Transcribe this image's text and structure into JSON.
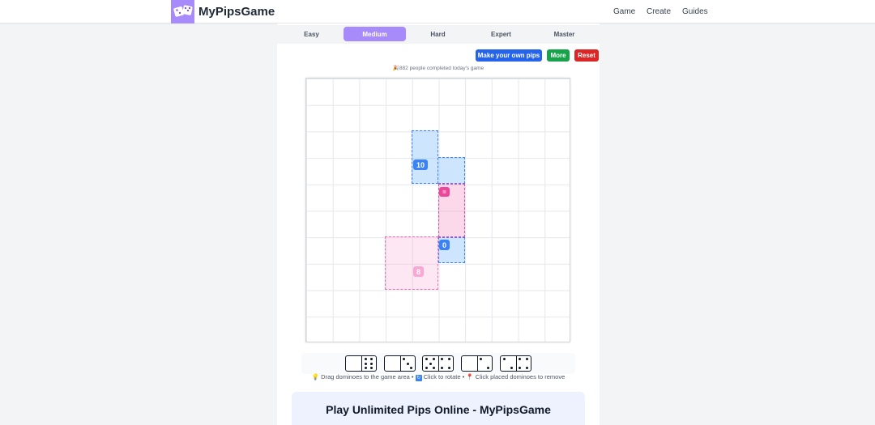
{
  "header": {
    "brand": "MyPipsGame",
    "nav": [
      "Game",
      "Create",
      "Guides"
    ]
  },
  "difficulty": {
    "tabs": [
      "Easy",
      "Medium",
      "Hard",
      "Expert",
      "Master"
    ],
    "active": "Medium"
  },
  "actions": {
    "make_own": "Make your own pips",
    "more": "More",
    "reset": "Reset"
  },
  "status": {
    "completed": "882 people completed today's game"
  },
  "board": {
    "rows": 10,
    "cols": 10,
    "regions": [
      {
        "color": "blue",
        "label": "10"
      },
      {
        "color": "pink",
        "label": "="
      },
      {
        "color": "blue",
        "label": "0"
      },
      {
        "color": "lightpink",
        "label": "8"
      }
    ]
  },
  "tray": {
    "dominoes": [
      [
        0,
        6
      ],
      [
        0,
        3
      ],
      [
        5,
        4
      ],
      [
        0,
        2
      ],
      [
        2,
        4
      ]
    ]
  },
  "hints": {
    "drag": "Drag dominoes to the game area",
    "rotate": "Click to rotate",
    "remove": "Click placed dominoes to remove"
  },
  "footer": {
    "title": "Play Unlimited Pips Online - MyPipsGame"
  },
  "colors": {
    "accent": "#a78bfa",
    "make_own": "#2563eb",
    "more": "#16a34a",
    "reset": "#dc2626",
    "region_blue": "#3b82f6",
    "region_pink": "#ec4899"
  }
}
